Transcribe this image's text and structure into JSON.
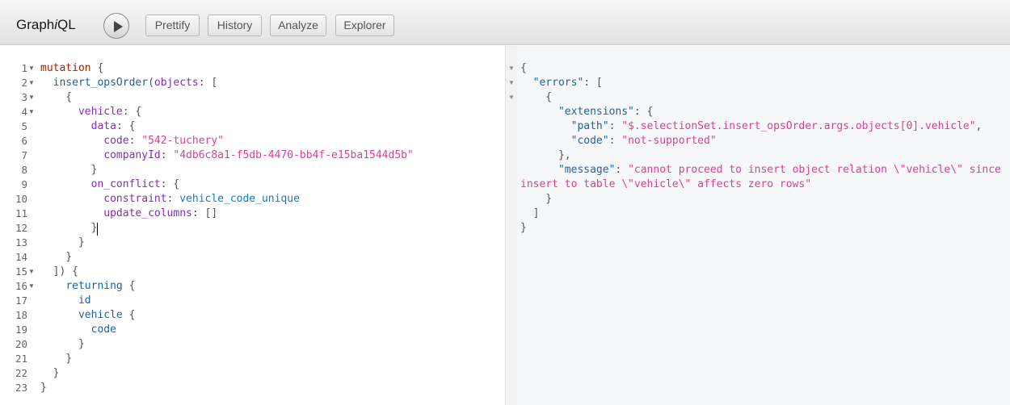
{
  "app": {
    "logo_text": "Graph",
    "logo_italic": "i",
    "logo_suffix": "QL"
  },
  "toolbar": {
    "run_icon": "play-icon",
    "buttons": [
      {
        "label": "Prettify"
      },
      {
        "label": "History"
      },
      {
        "label": "Analyze"
      },
      {
        "label": "Explorer"
      }
    ]
  },
  "query_editor": {
    "line_numbers": [
      "1",
      "2",
      "3",
      "4",
      "5",
      "6",
      "7",
      "8",
      "9",
      "10",
      "11",
      "12",
      "13",
      "14",
      "15",
      "16",
      "17",
      "18",
      "19",
      "20",
      "21",
      "22",
      "23"
    ],
    "lines": [
      [
        {
          "t": "mutation",
          "c": "kw"
        },
        {
          "t": " {",
          "c": "pn"
        }
      ],
      [
        {
          "t": "  ",
          "c": "pn"
        },
        {
          "t": "insert_opsOrder",
          "c": "fn"
        },
        {
          "t": "(",
          "c": "pn"
        },
        {
          "t": "objects",
          "c": "arg"
        },
        {
          "t": ": [",
          "c": "pn"
        }
      ],
      [
        {
          "t": "    {",
          "c": "pn"
        }
      ],
      [
        {
          "t": "      ",
          "c": "pn"
        },
        {
          "t": "vehicle",
          "c": "arg"
        },
        {
          "t": ": {",
          "c": "pn"
        }
      ],
      [
        {
          "t": "        ",
          "c": "pn"
        },
        {
          "t": "data",
          "c": "arg"
        },
        {
          "t": ": {",
          "c": "pn"
        }
      ],
      [
        {
          "t": "          ",
          "c": "pn"
        },
        {
          "t": "code",
          "c": "arg"
        },
        {
          "t": ": ",
          "c": "pn"
        },
        {
          "t": "\"542-tuchery\"",
          "c": "str"
        }
      ],
      [
        {
          "t": "          ",
          "c": "pn"
        },
        {
          "t": "companyId",
          "c": "arg"
        },
        {
          "t": ": ",
          "c": "pn"
        },
        {
          "t": "\"4db6c8a1-f5db-4470-bb4f-e15ba1544d5b\"",
          "c": "str"
        }
      ],
      [
        {
          "t": "        }",
          "c": "pn"
        }
      ],
      [
        {
          "t": "        ",
          "c": "pn"
        },
        {
          "t": "on_conflict",
          "c": "arg"
        },
        {
          "t": ": {",
          "c": "pn"
        }
      ],
      [
        {
          "t": "          ",
          "c": "pn"
        },
        {
          "t": "constraint",
          "c": "arg"
        },
        {
          "t": ": ",
          "c": "pn"
        },
        {
          "t": "vehicle_code_unique",
          "c": "enum"
        }
      ],
      [
        {
          "t": "          ",
          "c": "pn"
        },
        {
          "t": "update_columns",
          "c": "arg"
        },
        {
          "t": ": []",
          "c": "pn"
        }
      ],
      [
        {
          "t": "        }",
          "c": "pn"
        }
      ],
      [
        {
          "t": "      }",
          "c": "pn"
        }
      ],
      [
        {
          "t": "    }",
          "c": "pn"
        }
      ],
      [
        {
          "t": "  ]) {",
          "c": "pn"
        }
      ],
      [
        {
          "t": "    ",
          "c": "pn"
        },
        {
          "t": "returning",
          "c": "fn"
        },
        {
          "t": " {",
          "c": "pn"
        }
      ],
      [
        {
          "t": "      ",
          "c": "pn"
        },
        {
          "t": "id",
          "c": "fn"
        }
      ],
      [
        {
          "t": "      ",
          "c": "pn"
        },
        {
          "t": "vehicle",
          "c": "fn"
        },
        {
          "t": " {",
          "c": "pn"
        }
      ],
      [
        {
          "t": "        ",
          "c": "pn"
        },
        {
          "t": "code",
          "c": "fn"
        }
      ],
      [
        {
          "t": "      }",
          "c": "pn"
        }
      ],
      [
        {
          "t": "    }",
          "c": "pn"
        }
      ],
      [
        {
          "t": "  }",
          "c": "pn"
        }
      ],
      [
        {
          "t": "}",
          "c": "pn"
        }
      ]
    ],
    "fold_lines": [
      0,
      1,
      2,
      3,
      14,
      15
    ]
  },
  "result_viewer": {
    "lines": [
      [
        {
          "t": "{",
          "c": "pn"
        }
      ],
      [
        {
          "t": "  ",
          "c": "pn"
        },
        {
          "t": "\"errors\"",
          "c": "prop"
        },
        {
          "t": ": [",
          "c": "pn"
        }
      ],
      [
        {
          "t": "    {",
          "c": "pn"
        }
      ],
      [
        {
          "t": "      ",
          "c": "pn"
        },
        {
          "t": "\"extensions\"",
          "c": "prop"
        },
        {
          "t": ": {",
          "c": "pn"
        }
      ],
      [
        {
          "t": "        ",
          "c": "pn"
        },
        {
          "t": "\"path\"",
          "c": "prop"
        },
        {
          "t": ": ",
          "c": "pn"
        },
        {
          "t": "\"$.selectionSet.insert_opsOrder.args.objects[0].vehicle\"",
          "c": "str"
        },
        {
          "t": ",",
          "c": "pn"
        }
      ],
      [
        {
          "t": "        ",
          "c": "pn"
        },
        {
          "t": "\"code\"",
          "c": "prop"
        },
        {
          "t": ": ",
          "c": "pn"
        },
        {
          "t": "\"not-supported\"",
          "c": "str"
        }
      ],
      [
        {
          "t": "      },",
          "c": "pn"
        }
      ],
      [
        {
          "t": "      ",
          "c": "pn"
        },
        {
          "t": "\"message\"",
          "c": "prop"
        },
        {
          "t": ": ",
          "c": "pn"
        },
        {
          "t": "\"cannot proceed to insert object relation \\\"vehicle\\\" since",
          "c": "str"
        }
      ],
      [
        {
          "t": "insert to table \\\"vehicle\\\" affects zero rows\"",
          "c": "str"
        }
      ],
      [
        {
          "t": "    }",
          "c": "pn"
        }
      ],
      [
        {
          "t": "  ]",
          "c": "pn"
        }
      ],
      [
        {
          "t": "}",
          "c": "pn"
        }
      ]
    ],
    "fold_lines": [
      0,
      1,
      2
    ]
  }
}
